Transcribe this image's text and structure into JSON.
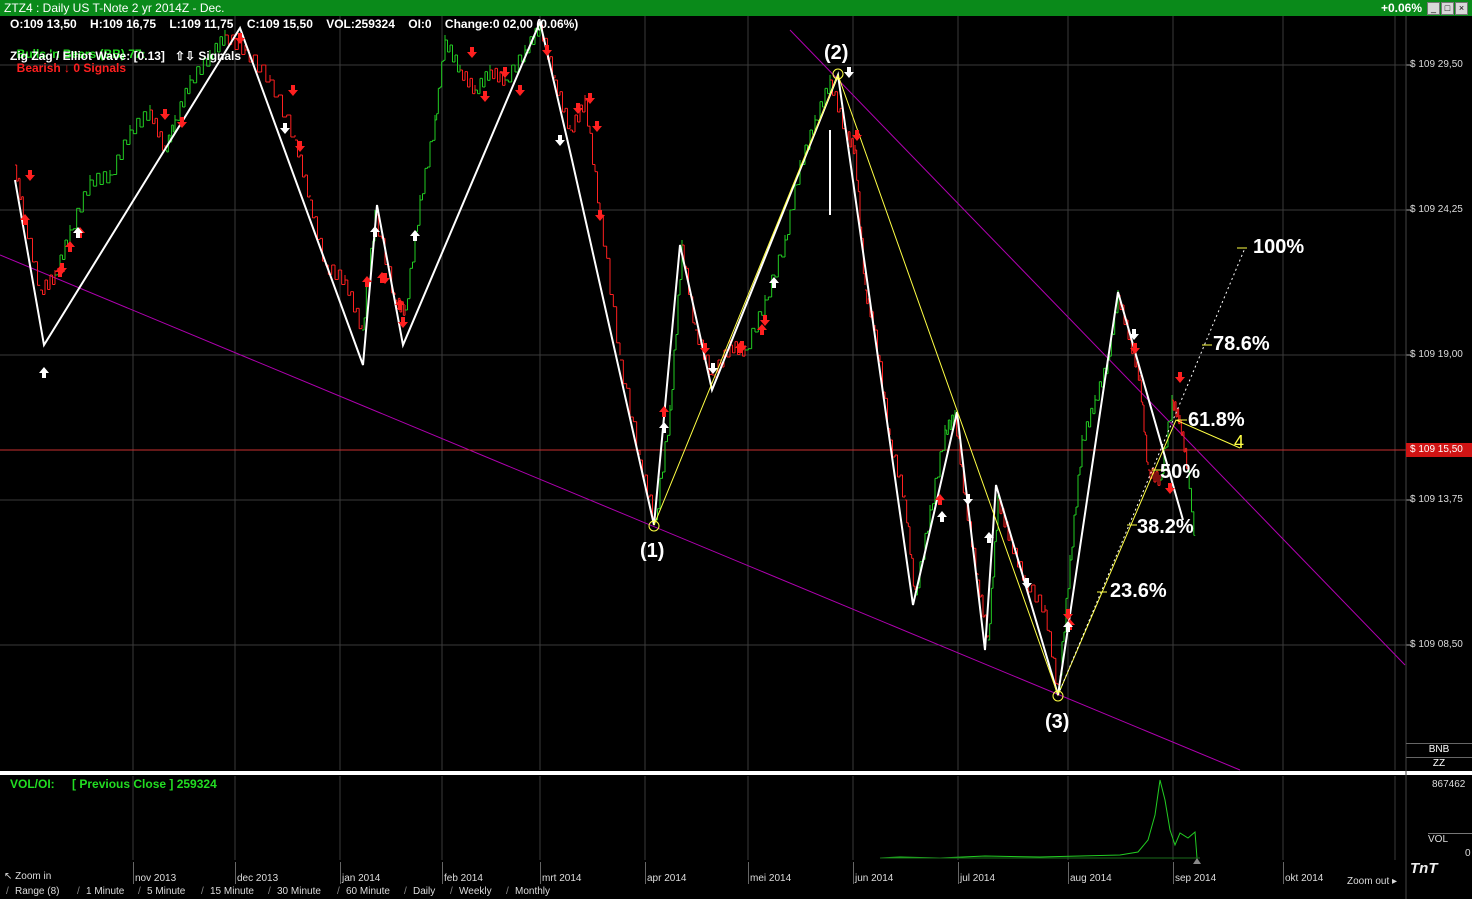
{
  "window": {
    "title": "ZTZ4 : Daily US T-Note 2 yr 2014Z - Dec.",
    "change_badge": "+0.06%",
    "buttons": [
      "_",
      "□",
      "×"
    ]
  },
  "header": {
    "ohlc_line": "O:109 13,50    H:109 16,75    L:109 11,75    C:109 15,50    VOL:259324    OI:0    Change:0 02,00 (0.06%)",
    "indicator1_name": "Bulls 'n Bears (BB) 77:",
    "indicator1_state": "Bearish ↓ 0 Signals",
    "indicator2": "Zig Zag / Elliot Wave: [0.13]   ⇧⇩ Signals"
  },
  "price_axis": {
    "ticks": [
      "$ 109 29,50",
      "$ 109 24,25",
      "$ 109 19,00",
      "$ 109 13,75",
      "$ 109 08,50"
    ],
    "current": "$ 109 15,50"
  },
  "wave_labels": [
    "(1)",
    "(2)",
    "(3)",
    "4"
  ],
  "fib_levels": [
    "100%",
    "78.6%",
    "61.8%",
    "50%",
    "38.2%",
    "23.6%"
  ],
  "side_tags": [
    "BNB",
    "ZZ"
  ],
  "volume_panel": {
    "title": "VOL/OI:",
    "prev_close": "[ Previous Close ] 259324",
    "axis_top": "867462",
    "axis_mid": "VOL",
    "axis_bottom": "0"
  },
  "time_axis": [
    "nov 2013",
    "dec 2013",
    "jan 2014",
    "feb 2014",
    "mrt 2014",
    "apr 2014",
    "mei 2014",
    "jun 2014",
    "jul 2014",
    "aug 2014",
    "sep 2014",
    "okt 2014"
  ],
  "controls": {
    "zoom_in": "Zoom in",
    "zoom_out": "Zoom out",
    "logo": "TnT"
  },
  "timeframes": [
    "Range (8)",
    "1 Minute",
    "5 Minute",
    "15 Minute",
    "30 Minute",
    "60 Minute",
    "Daily",
    "Weekly",
    "Monthly"
  ],
  "colors": {
    "titlebar": "#0a8a1a",
    "bull": "#22cc22",
    "bear": "#ff2020",
    "zigzag": "#ffffff",
    "wave": "#ffff44",
    "trendline": "#b000b0",
    "current_price": "#d01414"
  }
}
